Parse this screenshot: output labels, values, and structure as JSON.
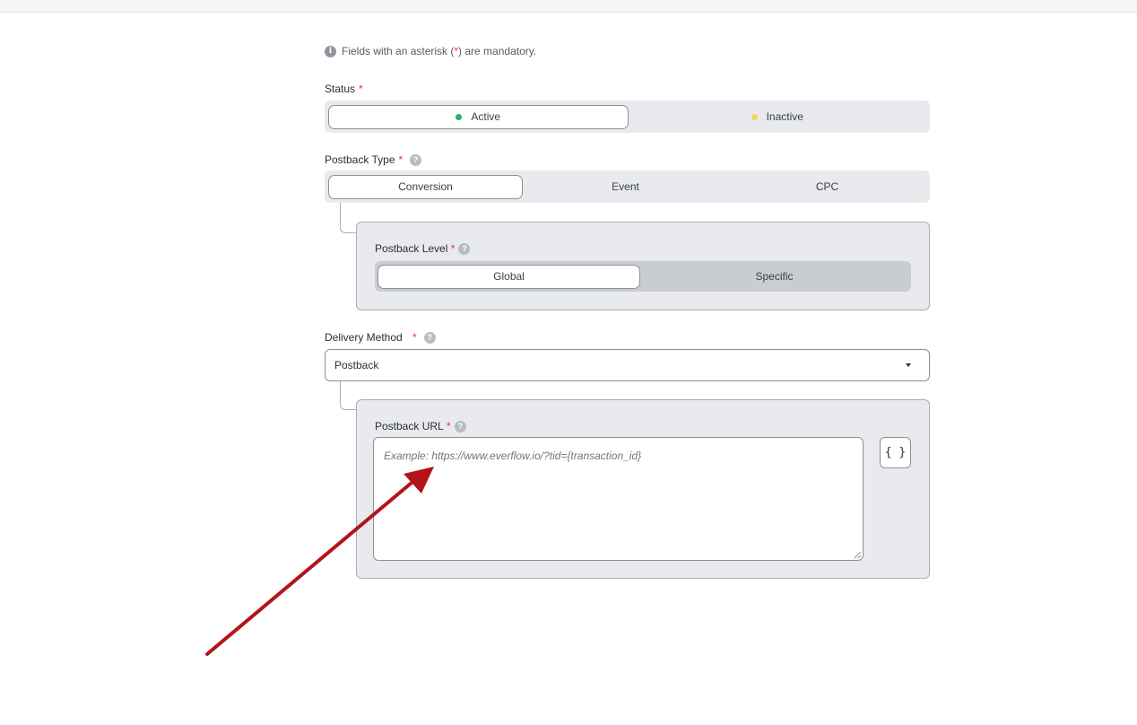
{
  "note": {
    "icon": "info-icon",
    "text_before": "Fields with an asterisk (",
    "asterisk": "*",
    "text_after": ") are mandatory."
  },
  "status": {
    "label": "Status",
    "required": "*",
    "options": [
      {
        "label": "Active",
        "selected": true,
        "dot_color": "#1fb46a"
      },
      {
        "label": "Inactive",
        "selected": false,
        "dot_color": "#f6d36b"
      }
    ]
  },
  "postback_type": {
    "label": "Postback Type",
    "required": "*",
    "help_icon": "help-icon",
    "options": [
      {
        "label": "Conversion",
        "selected": true
      },
      {
        "label": "Event",
        "selected": false
      },
      {
        "label": "CPC",
        "selected": false
      }
    ]
  },
  "postback_level": {
    "label": "Postback Level",
    "required": "*",
    "help_icon": "help-icon",
    "options": [
      {
        "label": "Global",
        "selected": true
      },
      {
        "label": "Specific",
        "selected": false
      }
    ]
  },
  "delivery_method": {
    "label": "Delivery Method",
    "required": "*",
    "help_icon": "help-icon",
    "value": "Postback"
  },
  "postback_url": {
    "label": "Postback URL",
    "required": "*",
    "help_icon": "help-icon",
    "placeholder": "Example: https://www.everflow.io/?tid={transaction_id}",
    "value": "",
    "token_button": "{ }"
  },
  "colors": {
    "required": "#e2323f",
    "annotation_arrow": "#b3141a"
  }
}
